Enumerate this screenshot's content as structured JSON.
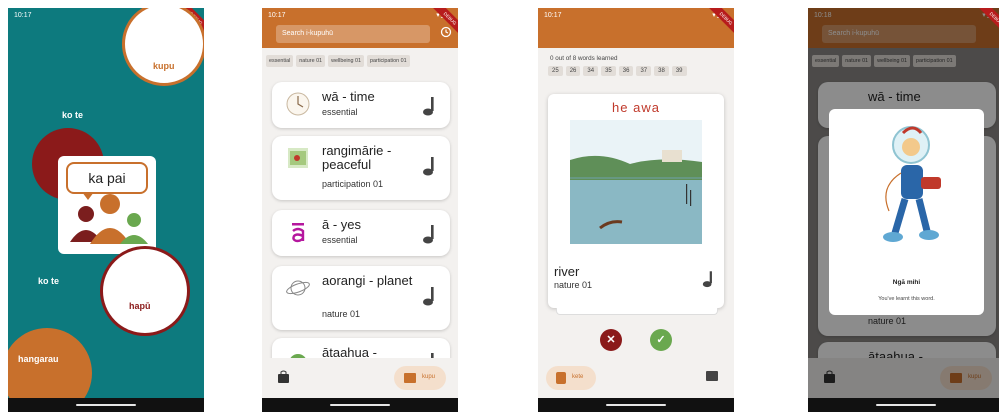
{
  "status": {
    "time_1": "10:17",
    "time_2": "10:17",
    "time_3": "10:17",
    "time_4": "10:18",
    "icons": "▾◢▮"
  },
  "ribbon": "DEBUG",
  "colors": {
    "accent": "#c8702c",
    "teal": "#0d7a7e",
    "maroon": "#8b1a1a",
    "green": "#6aa84f",
    "red": "#a52a2a"
  },
  "home": {
    "bubbles": [
      {
        "label": "kupu"
      },
      {
        "label": "ko te"
      },
      {
        "label": "ko te"
      },
      {
        "label": "hapū"
      },
      {
        "label": "hangarau"
      }
    ],
    "logo_text": "ka pai"
  },
  "list": {
    "search_placeholder": "Search i-kupuhū",
    "tags": [
      "essential",
      "nature 01",
      "wellbeing 01",
      "participation 01"
    ],
    "cards": [
      {
        "title": "wā - time",
        "subtitle": "essential",
        "icon": "clock-icon"
      },
      {
        "title": "rangimārie - peaceful",
        "subtitle": "participation 01",
        "icon": "book-icon"
      },
      {
        "title": "ā - yes",
        "subtitle": "essential",
        "icon": "macron-a-icon"
      },
      {
        "title": "aorangi - planet",
        "subtitle": "nature 01",
        "icon": "planet-icon"
      },
      {
        "title": "ātaahua -",
        "subtitle": "",
        "icon": "flower-icon"
      }
    ],
    "bottom": {
      "kupu_label": "kupu"
    }
  },
  "flashcard": {
    "progress_text": "0 out of 8 words learned",
    "numbers": [
      "25",
      "26",
      "34",
      "35",
      "36",
      "37",
      "38",
      "39"
    ],
    "maori": "he awa",
    "english": "river",
    "category": "nature 01",
    "bottom": {
      "kete_label": "kete"
    }
  },
  "learned": {
    "search_placeholder": "Search i-kupuhū",
    "tags": [
      "essential",
      "nature 01",
      "wellbeing 01",
      "participation 01"
    ],
    "card_title_1": "wā - time",
    "card_title_2": "ātaahua -",
    "behind_sub": "nature 01",
    "modal_title": "Ngā mihi",
    "modal_text": "You've learnt this word.",
    "bottom": {
      "kupu_label": "kupu"
    }
  }
}
